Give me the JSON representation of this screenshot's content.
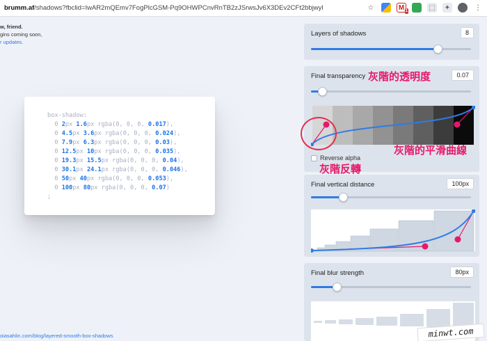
{
  "browser": {
    "url_host": "brumm.af",
    "url_path": "/shadows?fbclid=IwAR2mQEmv7FogPlcGSM-Pq9OHWPCnvRnTB2zJSrwsJv6X3DEv2CFt2bbjwyl",
    "icons": [
      "star-icon",
      "extension-icon-1",
      "gmail-icon",
      "extension-icon-2",
      "extension-icon-3",
      "extension-icon-4",
      "profile-icon",
      "menu-icon"
    ],
    "gmail_badge": "1"
  },
  "intro": {
    "line1": "w, friend.",
    "line2": "gins coming soon,",
    "line3": "r updates."
  },
  "code": {
    "header": "box-shadow:",
    "rows": [
      {
        "x": "0",
        "y": "2",
        "blur": "1.6",
        "alpha": "0.017",
        "sep": ","
      },
      {
        "x": "0",
        "y": "4.5",
        "blur": "3.6",
        "alpha": "0.024",
        "sep": ","
      },
      {
        "x": "0",
        "y": "7.9",
        "blur": "6.3",
        "alpha": "0.03",
        "sep": ","
      },
      {
        "x": "0",
        "y": "12.5",
        "blur": "10",
        "alpha": "0.035",
        "sep": ","
      },
      {
        "x": "0",
        "y": "19.3",
        "blur": "15.5",
        "alpha": "0.04",
        "sep": ","
      },
      {
        "x": "0",
        "y": "30.1",
        "blur": "24.1",
        "alpha": "0.046",
        "sep": ","
      },
      {
        "x": "0",
        "y": "50",
        "blur": "40",
        "alpha": "0.053",
        "sep": ","
      },
      {
        "x": "0",
        "y": "100",
        "blur": "80",
        "alpha": "0.07",
        "sep": ""
      }
    ],
    "footer": ";"
  },
  "footer_link": "oiasahlin.com/blog/layered-smooth-box-shadows",
  "panels": {
    "layers": {
      "title": "Layers of shadows",
      "value": "8",
      "slider_fraction": 0.79
    },
    "transparency": {
      "title": "Final transparency",
      "value": "0.07",
      "slider_fraction": 0.07,
      "reverse_label": "Reverse alpha"
    },
    "vertical": {
      "title": "Final vertical distance",
      "value": "100px",
      "slider_fraction": 0.2
    },
    "blur": {
      "title": "Final blur strength",
      "value": "80px",
      "slider_fraction": 0.16
    }
  },
  "annotations": {
    "title_note": "灰階的透明度",
    "curve_note": "灰階的平滑曲線",
    "reverse_note": "灰階反轉",
    "color": "#e5196b"
  },
  "colors": {
    "accent": "#2f7be6",
    "handle": "#e5196b"
  },
  "watermark": "minwt.com"
}
